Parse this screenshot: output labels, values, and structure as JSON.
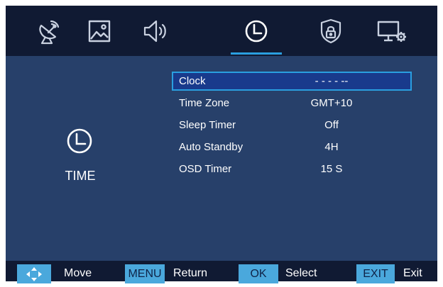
{
  "tabs": [
    {
      "icon": "satellite-dish-icon"
    },
    {
      "icon": "picture-icon"
    },
    {
      "icon": "speaker-icon"
    },
    {
      "icon": "clock-icon",
      "active": true
    },
    {
      "icon": "shield-lock-icon"
    },
    {
      "icon": "monitor-settings-icon"
    }
  ],
  "section": {
    "title": "TIME",
    "icon": "clock-icon"
  },
  "menu": [
    {
      "label": "Clock",
      "value": "- - - - --",
      "selected": true
    },
    {
      "label": "Time Zone",
      "value": "GMT+10"
    },
    {
      "label": "Sleep Timer",
      "value": "Off"
    },
    {
      "label": "Auto Standby",
      "value": "4H"
    },
    {
      "label": "OSD Timer",
      "value": "15 S"
    }
  ],
  "footer": {
    "move_label": "Move",
    "menu_key": "MENU",
    "return_label": "Return",
    "ok_key": "OK",
    "select_label": "Select",
    "exit_key": "EXIT",
    "exit_label": "Exit"
  },
  "colors": {
    "background": "#27406a",
    "bar": "#101a33",
    "accent": "#2a9fe0",
    "key": "#4aa8dc",
    "selected_row": "#193a8c"
  }
}
